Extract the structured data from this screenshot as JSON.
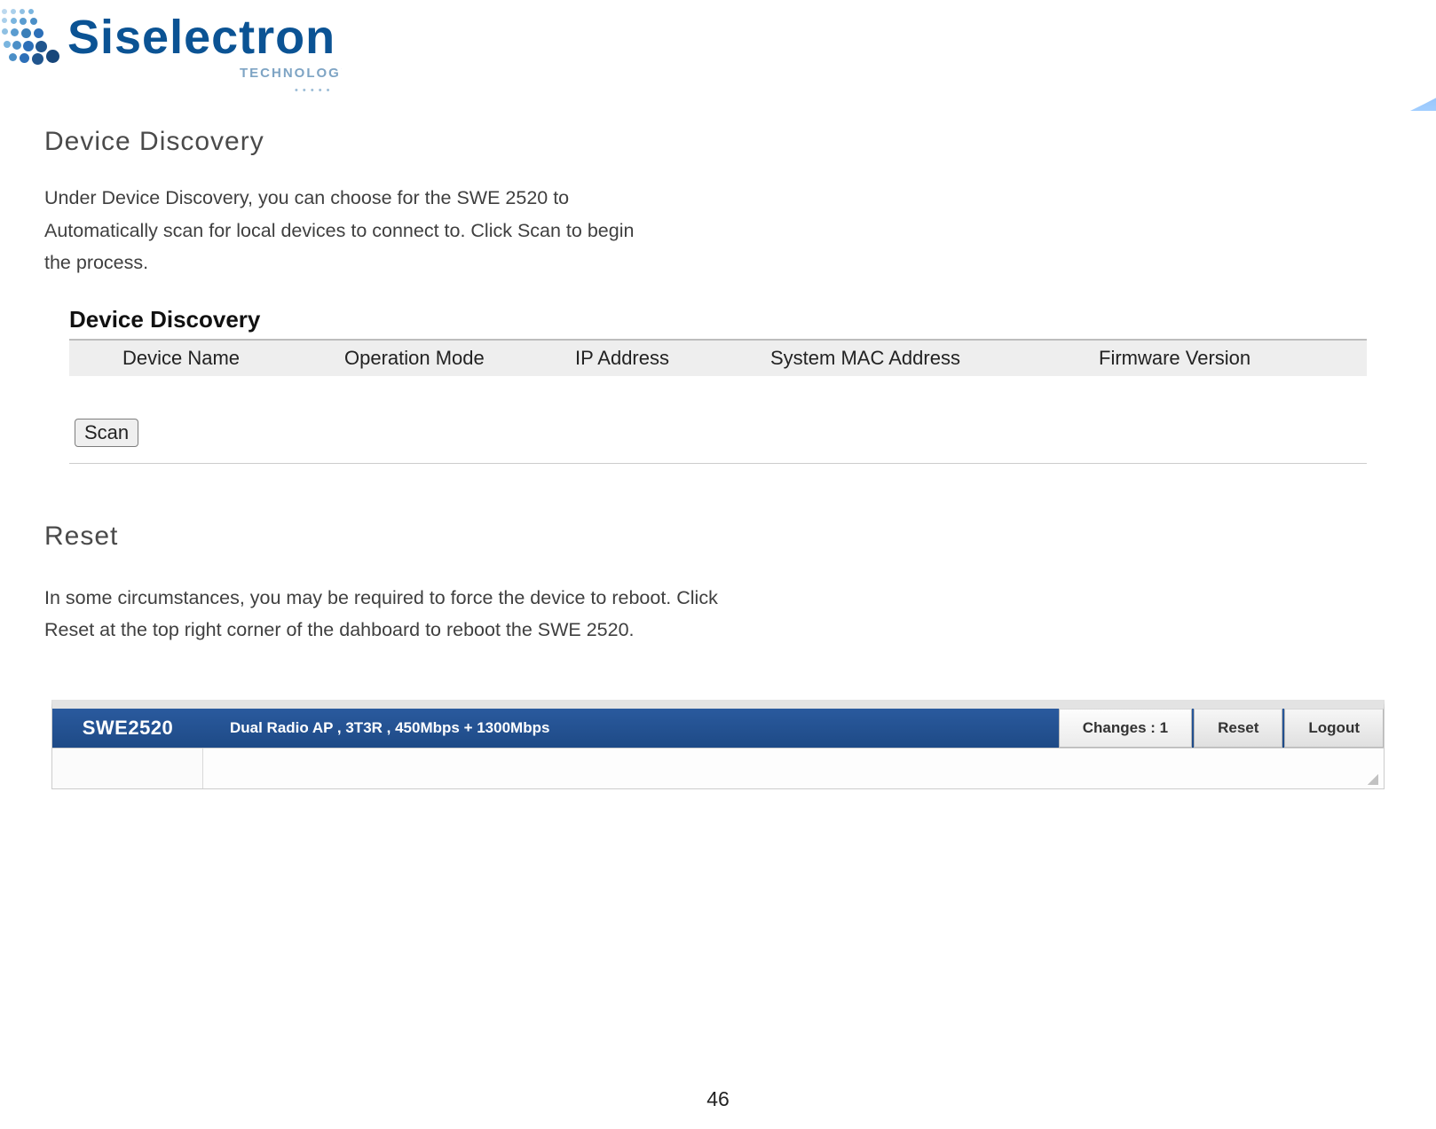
{
  "brand": {
    "name": "Siselectron",
    "tagline": "TECHNOLOGY"
  },
  "device_discovery": {
    "heading": "Device  Discovery",
    "paragraph": "Under Device Discovery, you can choose  for the  SWE  2520 to Automatically  scan  for local devices  to  connect to.  Click Scan  to  begin  the  process.",
    "panel_title": "Device Discovery",
    "columns": {
      "name": "Device Name",
      "mode": "Operation Mode",
      "ip": "IP Address",
      "mac": "System MAC Address",
      "fw": "Firmware Version"
    },
    "scan_label": "Scan"
  },
  "reset": {
    "heading": "Reset",
    "paragraph": "In some circumstances,  you may be required to force the device to reboot. Click Reset  at the top right corner of  the  dahboard  to reboot the  SWE 2520."
  },
  "dashboard": {
    "device": "SWE2520",
    "description": "Dual Radio AP , 3T3R , 450Mbps + 1300Mbps",
    "changes_label": "Changes : 1",
    "reset_label": "Reset",
    "logout_label": "Logout"
  },
  "page_number": "46"
}
